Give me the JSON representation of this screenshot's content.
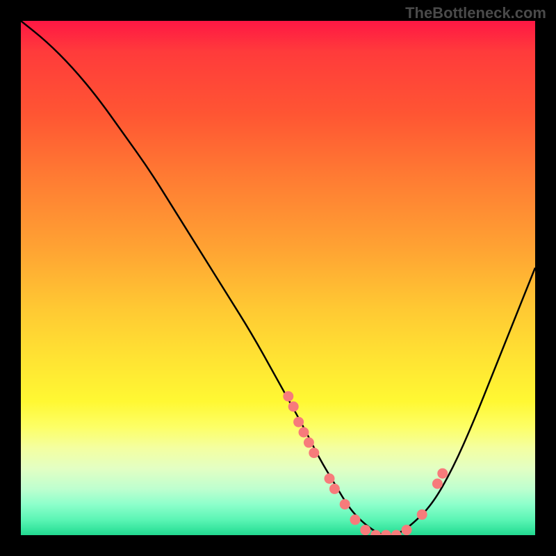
{
  "watermark": "TheBottleneck.com",
  "chart_data": {
    "type": "line",
    "title": "",
    "xlabel": "",
    "ylabel": "",
    "xlim": [
      0,
      100
    ],
    "ylim": [
      0,
      100
    ],
    "grid": false,
    "legend": false,
    "background_gradient": {
      "stops": [
        {
          "pos": 0,
          "color": "#ff1744"
        },
        {
          "pos": 18,
          "color": "#ff5533"
        },
        {
          "pos": 44,
          "color": "#ffa233"
        },
        {
          "pos": 66,
          "color": "#ffe433"
        },
        {
          "pos": 83,
          "color": "#f4ffa0"
        },
        {
          "pos": 100,
          "color": "#22d88f"
        }
      ]
    },
    "series": [
      {
        "name": "bottleneck-curve",
        "type": "line",
        "color": "#000000",
        "x": [
          0,
          5,
          10,
          15,
          20,
          25,
          30,
          35,
          40,
          45,
          50,
          55,
          58,
          61,
          64,
          67,
          70,
          73,
          76,
          80,
          84,
          88,
          92,
          96,
          100
        ],
        "y": [
          100,
          96,
          91,
          85,
          78,
          71,
          63,
          55,
          47,
          39,
          30,
          21,
          15,
          10,
          5,
          2,
          0,
          0,
          2,
          6,
          13,
          22,
          32,
          42,
          52
        ]
      },
      {
        "name": "bottleneck-points",
        "type": "scatter",
        "color": "#f77b7b",
        "x": [
          52,
          53,
          54,
          55,
          56,
          57,
          60,
          61,
          63,
          65,
          67,
          69,
          71,
          73,
          75,
          78,
          81,
          82
        ],
        "y": [
          27,
          25,
          22,
          20,
          18,
          16,
          11,
          9,
          6,
          3,
          1,
          0,
          0,
          0,
          1,
          4,
          10,
          12
        ]
      }
    ]
  },
  "colors": {
    "curve": "#000000",
    "point_fill": "#f77b7b",
    "point_stroke": "#e86a6a",
    "watermark": "#4a4a4a",
    "frame": "#000000"
  }
}
